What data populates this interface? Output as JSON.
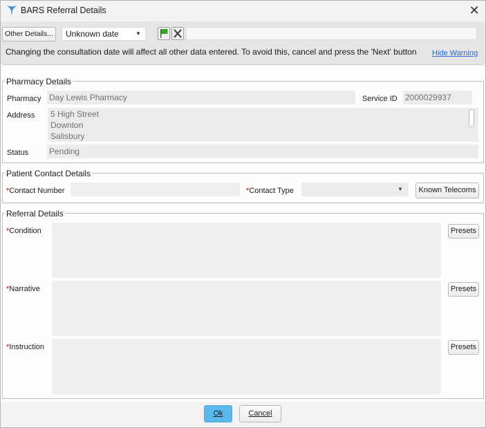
{
  "window": {
    "title": "BARS Referral Details",
    "close_glyph": "✕"
  },
  "toolbar": {
    "other_details_label": "Other Details...",
    "date_value": "Unknown date",
    "flag_icon": "green-flag-icon",
    "clear_icon": "x-icon",
    "input_value": "",
    "warning_text": "Changing the consultation date will affect all other data entered. To avoid this, cancel and press the 'Next' button",
    "hide_warning_label": "Hide Warning"
  },
  "pharmacy": {
    "legend": "Pharmacy Details",
    "pharmacy_label": "Pharmacy",
    "pharmacy_value": "Day Lewis Pharmacy",
    "service_id_label": "Service ID",
    "service_id_value": "2000029937",
    "address_label": "Address",
    "address_lines": [
      "5 High Street",
      "Downton",
      "Salisbury"
    ],
    "status_label": "Status",
    "status_value": "Pending"
  },
  "patient_contact": {
    "legend": "Patient Contact Details",
    "contact_number_label": "Contact Number",
    "contact_number_value": "",
    "contact_type_label": "Contact Type",
    "contact_type_value": "",
    "known_telecoms_label": "Known Telecoms"
  },
  "referral": {
    "legend": "Referral Details",
    "condition_label": "Condition",
    "narrative_label": "Narrative",
    "instruction_label": "Instruction",
    "presets_label": "Presets",
    "required_marker": "*"
  },
  "footer": {
    "ok_label": "Ok",
    "cancel_label": "Cancel"
  },
  "colors": {
    "ok_accent": "#5ab8ec",
    "required": "#c00000",
    "link": "#2a6ac9",
    "flag": "#3aa22b"
  }
}
